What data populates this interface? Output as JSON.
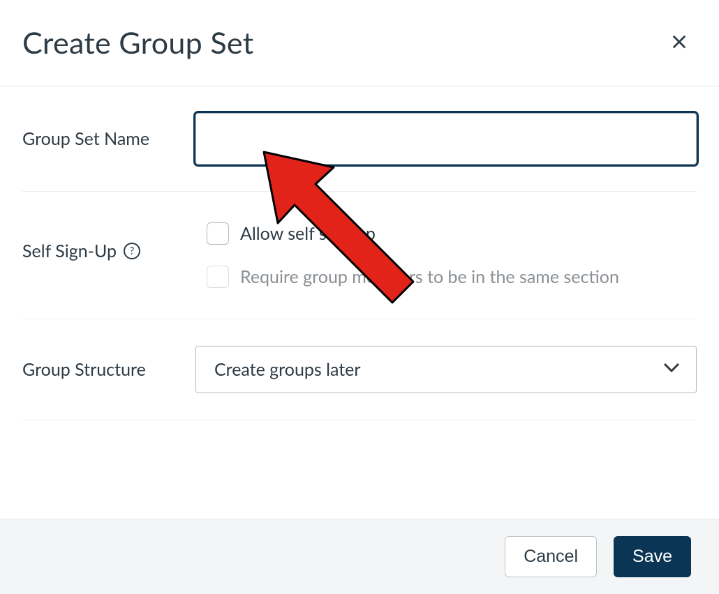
{
  "header": {
    "title": "Create Group Set"
  },
  "fields": {
    "group_set_name": {
      "label": "Group Set Name",
      "value": "",
      "placeholder": ""
    },
    "self_sign_up": {
      "label": "Self Sign-Up",
      "help_glyph": "?",
      "options": {
        "allow": {
          "label": "Allow self sign-up",
          "checked": false,
          "enabled": true
        },
        "same_section": {
          "label": "Require group members to be in the same section",
          "checked": false,
          "enabled": false
        }
      }
    },
    "group_structure": {
      "label": "Group Structure",
      "selected": "Create groups later"
    }
  },
  "footer": {
    "cancel": "Cancel",
    "save": "Save"
  }
}
